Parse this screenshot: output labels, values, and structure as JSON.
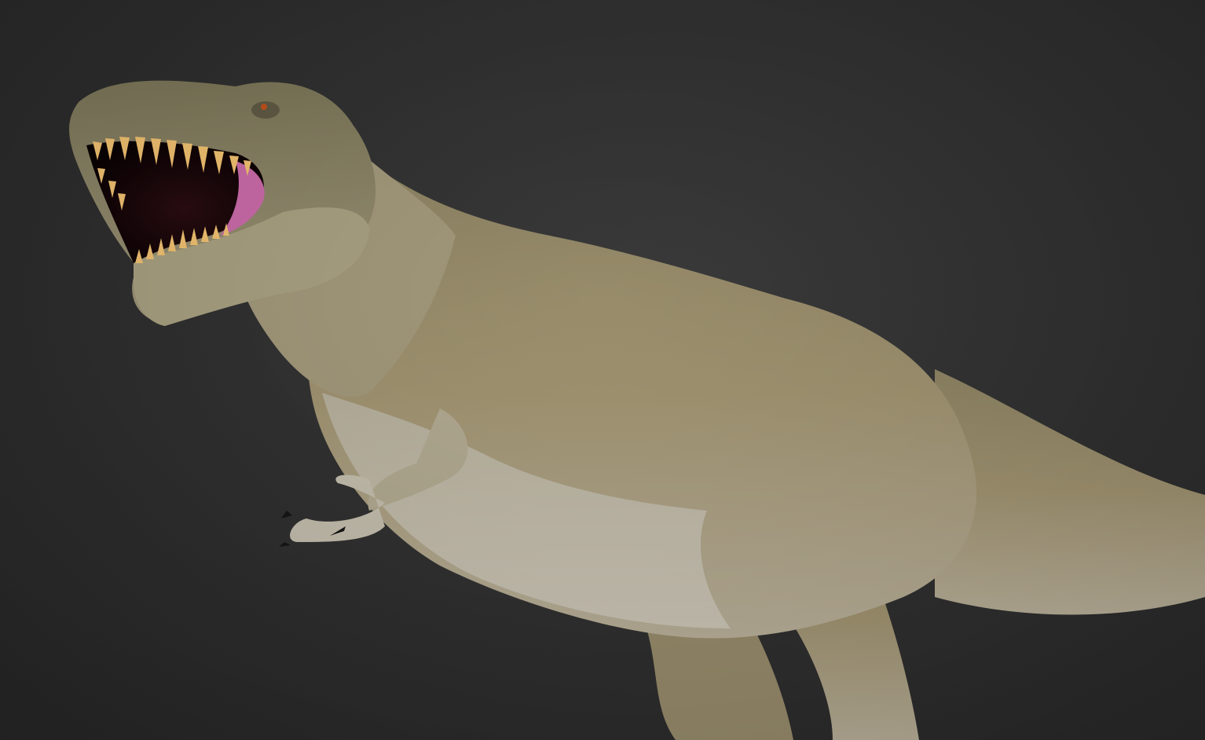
{
  "scene": {
    "background_color": "#2f2f2f",
    "subject": "trex-sculpt",
    "skin_color": "#9a8e6c",
    "belly_color": "#bdb6a6",
    "mouth_color": "#c86aa8",
    "teeth_color": "#f0c070",
    "claw_color": "#1a1a1a",
    "eye_color": "#c0501a"
  }
}
